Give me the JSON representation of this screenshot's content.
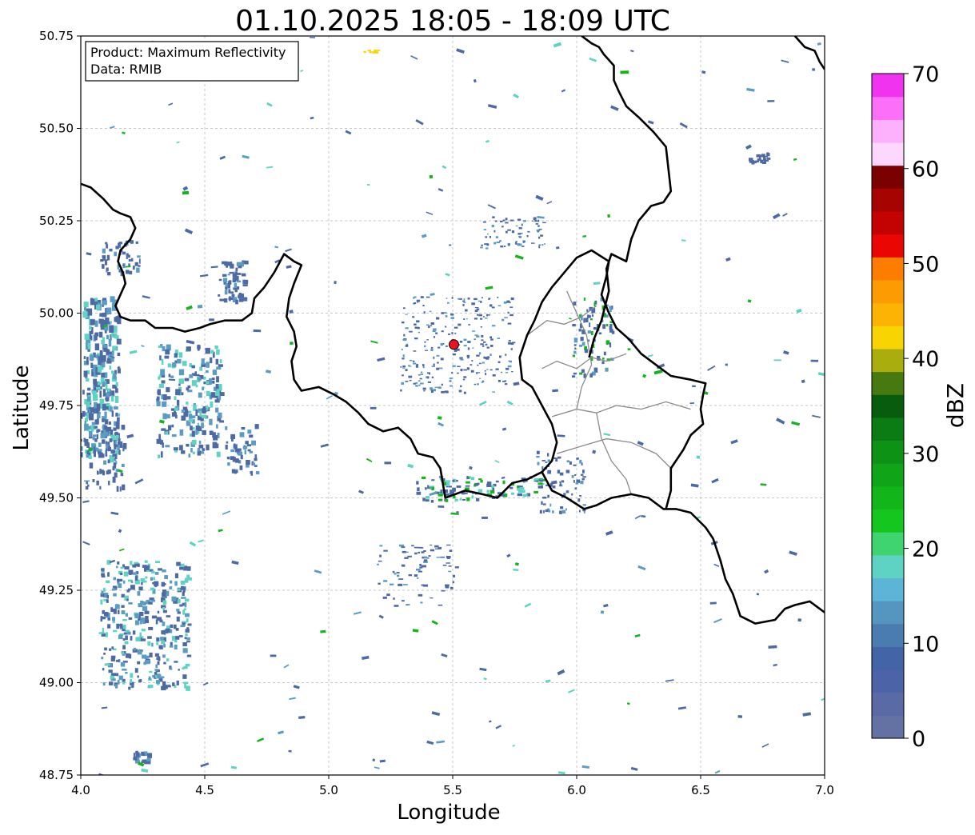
{
  "title": "01.10.2025 18:05 - 18:09 UTC",
  "info_box": {
    "product_line": "Product: Maximum Reflectivity",
    "data_line": "Data: RMIB"
  },
  "map": {
    "xlabel": "Longitude",
    "ylabel": "Latitude",
    "lon_range": [
      4.0,
      7.0
    ],
    "lat_range": [
      48.75,
      50.75
    ],
    "x_ticks": [
      "4.0",
      "4.5",
      "5.0",
      "5.5",
      "6.0",
      "6.5",
      "7.0"
    ],
    "y_ticks": [
      "48.75",
      "49.00",
      "49.25",
      "49.50",
      "49.75",
      "50.00",
      "50.25",
      "50.50",
      "50.75"
    ],
    "grid": true,
    "radar_site": {
      "lon": 5.505,
      "lat": 49.915,
      "color": "#e8141e"
    },
    "border_color": "#000000",
    "province_color": "#8a8a8a",
    "country_border": [
      [
        4.0,
        50.35
      ],
      [
        4.04,
        50.34
      ],
      [
        4.09,
        50.31
      ],
      [
        4.13,
        50.28
      ],
      [
        4.16,
        50.27
      ],
      [
        4.2,
        50.26
      ],
      [
        4.22,
        50.23
      ],
      [
        4.2,
        50.2
      ],
      [
        4.16,
        50.17
      ],
      [
        4.15,
        50.14
      ],
      [
        4.17,
        50.11
      ],
      [
        4.18,
        50.08
      ],
      [
        4.16,
        50.05
      ],
      [
        4.14,
        50.02
      ],
      [
        4.16,
        49.99
      ],
      [
        4.2,
        49.98
      ],
      [
        4.26,
        49.98
      ],
      [
        4.3,
        49.96
      ],
      [
        4.37,
        49.96
      ],
      [
        4.42,
        49.95
      ],
      [
        4.48,
        49.96
      ],
      [
        4.52,
        49.97
      ],
      [
        4.58,
        49.98
      ],
      [
        4.65,
        49.98
      ],
      [
        4.69,
        50.0
      ],
      [
        4.7,
        50.04
      ],
      [
        4.74,
        50.07
      ],
      [
        4.78,
        50.11
      ],
      [
        4.82,
        50.16
      ],
      [
        4.86,
        50.14
      ],
      [
        4.89,
        50.13
      ],
      [
        4.86,
        50.08
      ],
      [
        4.84,
        50.04
      ],
      [
        4.83,
        49.99
      ],
      [
        4.86,
        49.95
      ],
      [
        4.87,
        49.91
      ],
      [
        4.85,
        49.87
      ],
      [
        4.86,
        49.82
      ],
      [
        4.89,
        49.79
      ],
      [
        4.96,
        49.8
      ],
      [
        5.02,
        49.78
      ],
      [
        5.07,
        49.76
      ],
      [
        5.12,
        49.73
      ],
      [
        5.16,
        49.7
      ],
      [
        5.22,
        49.68
      ],
      [
        5.28,
        49.69
      ],
      [
        5.33,
        49.66
      ],
      [
        5.36,
        49.62
      ],
      [
        5.42,
        49.61
      ],
      [
        5.45,
        49.58
      ],
      [
        5.47,
        49.5
      ],
      [
        5.55,
        49.52
      ],
      [
        5.62,
        49.51
      ],
      [
        5.68,
        49.5
      ],
      [
        5.74,
        49.54
      ],
      [
        5.8,
        49.55
      ],
      [
        5.86,
        49.57
      ],
      [
        5.9,
        49.52
      ],
      [
        5.96,
        49.5
      ],
      [
        6.03,
        49.47
      ],
      [
        6.08,
        49.48
      ],
      [
        6.14,
        49.5
      ],
      [
        6.22,
        49.51
      ],
      [
        6.29,
        49.5
      ],
      [
        6.35,
        49.47
      ],
      [
        6.4,
        49.47
      ],
      [
        6.46,
        49.46
      ],
      [
        6.52,
        49.42
      ],
      [
        6.55,
        49.39
      ],
      [
        6.58,
        49.33
      ],
      [
        6.6,
        49.28
      ],
      [
        6.63,
        49.24
      ],
      [
        6.66,
        49.18
      ],
      [
        6.72,
        49.16
      ],
      [
        6.8,
        49.17
      ],
      [
        6.84,
        49.2
      ],
      [
        6.88,
        49.21
      ],
      [
        6.94,
        49.22
      ],
      [
        7.0,
        49.19
      ]
    ],
    "border_west_east": [
      [
        6.88,
        50.75
      ],
      [
        6.92,
        50.72
      ],
      [
        6.96,
        50.71
      ],
      [
        6.98,
        50.68
      ],
      [
        7.0,
        50.66
      ]
    ],
    "border_north_east": [
      [
        6.02,
        50.75
      ],
      [
        6.06,
        50.73
      ],
      [
        6.09,
        50.72
      ],
      [
        6.11,
        50.7
      ],
      [
        6.15,
        50.67
      ],
      [
        6.15,
        50.63
      ],
      [
        6.17,
        50.6
      ],
      [
        6.2,
        50.56
      ],
      [
        6.25,
        50.53
      ],
      [
        6.31,
        50.49
      ],
      [
        6.36,
        50.45
      ],
      [
        6.37,
        50.39
      ],
      [
        6.38,
        50.33
      ],
      [
        6.35,
        50.3
      ],
      [
        6.3,
        50.29
      ],
      [
        6.25,
        50.25
      ],
      [
        6.22,
        50.2
      ],
      [
        6.2,
        50.14
      ],
      [
        6.14,
        50.16
      ],
      [
        6.12,
        50.12
      ],
      [
        6.13,
        50.06
      ],
      [
        6.1,
        49.98
      ],
      [
        6.07,
        49.93
      ],
      [
        6.05,
        49.88
      ]
    ],
    "lux_border": [
      [
        6.13,
        50.14
      ],
      [
        6.12,
        50.1
      ],
      [
        6.1,
        50.05
      ],
      [
        6.13,
        50.0
      ],
      [
        6.16,
        49.96
      ],
      [
        6.21,
        49.93
      ],
      [
        6.26,
        49.89
      ],
      [
        6.32,
        49.86
      ],
      [
        6.38,
        49.83
      ],
      [
        6.46,
        49.82
      ],
      [
        6.52,
        49.81
      ],
      [
        6.51,
        49.78
      ],
      [
        6.5,
        49.74
      ],
      [
        6.51,
        49.7
      ],
      [
        6.46,
        49.67
      ],
      [
        6.43,
        49.63
      ],
      [
        6.38,
        49.58
      ],
      [
        6.38,
        49.52
      ],
      [
        6.36,
        49.47
      ]
    ],
    "lux_west": [
      [
        5.86,
        49.57
      ],
      [
        5.9,
        49.6
      ],
      [
        5.92,
        49.65
      ],
      [
        5.9,
        49.7
      ],
      [
        5.86,
        49.75
      ],
      [
        5.82,
        49.8
      ],
      [
        5.78,
        49.82
      ],
      [
        5.77,
        49.88
      ],
      [
        5.8,
        49.94
      ],
      [
        5.83,
        49.98
      ],
      [
        5.86,
        50.03
      ],
      [
        5.9,
        50.07
      ],
      [
        5.95,
        50.11
      ],
      [
        6.0,
        50.15
      ],
      [
        6.06,
        50.17
      ],
      [
        6.13,
        50.14
      ]
    ],
    "provinces": [
      [
        [
          5.86,
          49.85
        ],
        [
          5.92,
          49.87
        ],
        [
          6.0,
          49.85
        ],
        [
          6.06,
          49.88
        ],
        [
          6.12,
          49.87
        ],
        [
          6.2,
          49.89
        ]
      ],
      [
        [
          5.9,
          49.72
        ],
        [
          6.0,
          49.74
        ],
        [
          6.08,
          49.73
        ],
        [
          6.16,
          49.75
        ],
        [
          6.26,
          49.74
        ],
        [
          6.36,
          49.76
        ],
        [
          6.46,
          49.74
        ]
      ],
      [
        [
          6.0,
          49.74
        ],
        [
          6.02,
          49.8
        ],
        [
          6.06,
          49.86
        ],
        [
          6.04,
          49.94
        ],
        [
          6.0,
          50.0
        ],
        [
          5.96,
          50.06
        ]
      ],
      [
        [
          5.92,
          49.62
        ],
        [
          6.02,
          49.64
        ],
        [
          6.12,
          49.66
        ],
        [
          6.22,
          49.65
        ],
        [
          6.32,
          49.62
        ],
        [
          6.38,
          49.58
        ]
      ],
      [
        [
          6.08,
          49.73
        ],
        [
          6.1,
          49.66
        ],
        [
          6.14,
          49.6
        ],
        [
          6.2,
          49.55
        ],
        [
          6.22,
          49.51
        ]
      ],
      [
        [
          5.8,
          49.94
        ],
        [
          5.88,
          49.98
        ],
        [
          5.95,
          49.97
        ],
        [
          6.02,
          49.99
        ],
        [
          6.08,
          50.02
        ]
      ]
    ]
  },
  "colorbar": {
    "label": "dBZ",
    "min": 0,
    "max": 70,
    "ticks": [
      "0",
      "10",
      "20",
      "30",
      "40",
      "50",
      "60",
      "70"
    ],
    "colors": [
      "#6472a3",
      "#5a6aa4",
      "#4d63a8",
      "#4364a6",
      "#4a7cb0",
      "#5496c0",
      "#5cb4d6",
      "#5fd3c3",
      "#3fd470",
      "#14c61e",
      "#12b61a",
      "#10a418",
      "#0e9216",
      "#0b7c13",
      "#075c0d",
      "#467a10",
      "#a9ae0e",
      "#f7d402",
      "#fcb304",
      "#fc9b02",
      "#fc7d01",
      "#e90603",
      "#c20301",
      "#a50401",
      "#7b0101",
      "#fdd8fe",
      "#fdb1fd",
      "#fc6ff9",
      "#ef33ee"
    ]
  },
  "echo_colors": {
    "weak": "#4d6aa6",
    "light": "#5b9cc4",
    "teal": "#5fd3c3",
    "green": "#14b41e",
    "yellow": "#f7d402"
  }
}
